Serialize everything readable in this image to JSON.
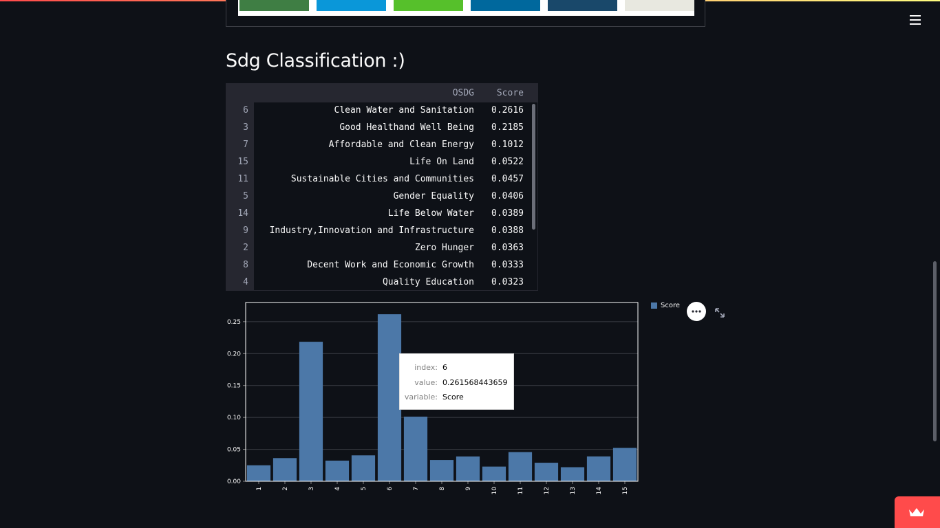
{
  "page": {
    "title": "Sdg Classification :)"
  },
  "header": {
    "menu_icon": "hamburger-icon"
  },
  "image_strip": {
    "tile_colors": [
      "#3f7e44",
      "#0a97d9",
      "#56c02b",
      "#00689d",
      "#19486a",
      "#e8e8e0"
    ]
  },
  "dataframe": {
    "columns": [
      "OSDG",
      "Score"
    ],
    "rows": [
      {
        "index": "6",
        "label": "Clean Water and Sanitation",
        "score": "0.2616"
      },
      {
        "index": "3",
        "label": "Good Healthand Well Being",
        "score": "0.2185"
      },
      {
        "index": "7",
        "label": "Affordable and Clean Energy",
        "score": "0.1012"
      },
      {
        "index": "15",
        "label": "Life On Land",
        "score": "0.0522"
      },
      {
        "index": "11",
        "label": "Sustainable Cities and Communities",
        "score": "0.0457"
      },
      {
        "index": "5",
        "label": "Gender Equality",
        "score": "0.0406"
      },
      {
        "index": "14",
        "label": "Life Below Water",
        "score": "0.0389"
      },
      {
        "index": "9",
        "label": "Industry,Innovation and Infrastructure",
        "score": "0.0388"
      },
      {
        "index": "2",
        "label": "Zero Hunger",
        "score": "0.0363"
      },
      {
        "index": "8",
        "label": "Decent Work and Economic Growth",
        "score": "0.0333"
      },
      {
        "index": "4",
        "label": "Quality Education",
        "score": "0.0323"
      }
    ]
  },
  "chart_data": {
    "type": "bar",
    "categories": [
      "1",
      "2",
      "3",
      "4",
      "5",
      "6",
      "7",
      "8",
      "9",
      "10",
      "11",
      "12",
      "13",
      "14",
      "15"
    ],
    "series": [
      {
        "name": "Score",
        "values": [
          0.025,
          0.0363,
          0.2185,
          0.0323,
          0.0406,
          0.2616,
          0.1012,
          0.0333,
          0.0388,
          0.023,
          0.0457,
          0.029,
          0.022,
          0.0389,
          0.0522
        ]
      }
    ],
    "y_ticks": [
      "0.00",
      "0.05",
      "0.10",
      "0.15",
      "0.20",
      "0.25"
    ],
    "ylim": [
      0,
      0.28
    ],
    "grid": true,
    "legend_position": "top-right",
    "colors": {
      "bar": "#4c78a8",
      "grid": "#3a3d45",
      "axis": "#ffffff"
    }
  },
  "tooltip": {
    "rows": [
      {
        "key": "index:",
        "value": "6"
      },
      {
        "key": "value:",
        "value": "0.261568443659"
      },
      {
        "key": "variable:",
        "value": "Score"
      }
    ]
  },
  "chart_actions": {
    "more_icon": "more-horizontal-icon",
    "expand_icon": "expand-icon"
  },
  "badge": {
    "icon": "crown-icon"
  }
}
